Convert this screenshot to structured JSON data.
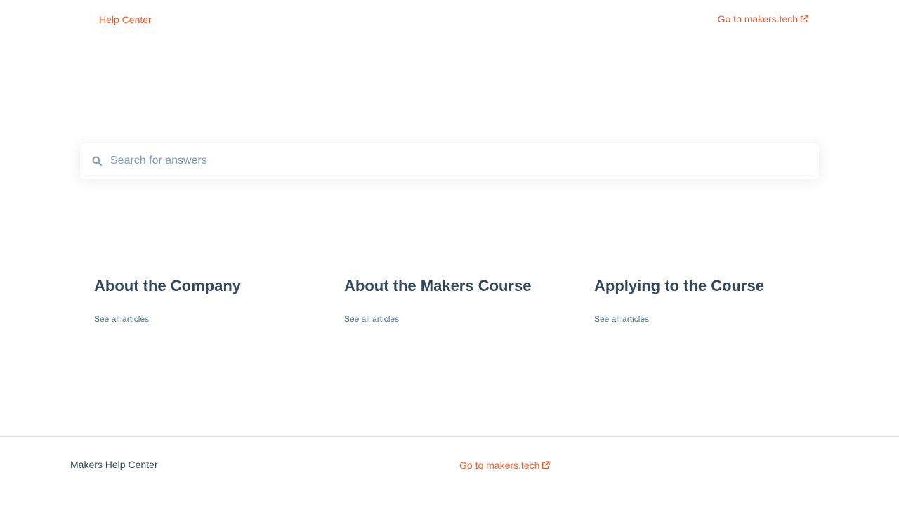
{
  "header": {
    "brand_label": "Help Center",
    "external_link_label": "Go to makers.tech"
  },
  "search": {
    "placeholder": "Search for answers"
  },
  "categories": [
    {
      "title": "About the Company",
      "link_label": "See all articles"
    },
    {
      "title": "About the Makers Course",
      "link_label": "See all articles"
    },
    {
      "title": "Applying to the Course",
      "link_label": "See all articles"
    }
  ],
  "footer": {
    "brand_label": "Makers Help Center",
    "external_link_label": "Go to makers.tech"
  },
  "colors": {
    "accent": "#f05a28",
    "heading": "#33475b",
    "muted_link": "#516f90",
    "placeholder": "#7c98b6"
  },
  "icons": [
    "external-link-icon",
    "search-icon"
  ]
}
